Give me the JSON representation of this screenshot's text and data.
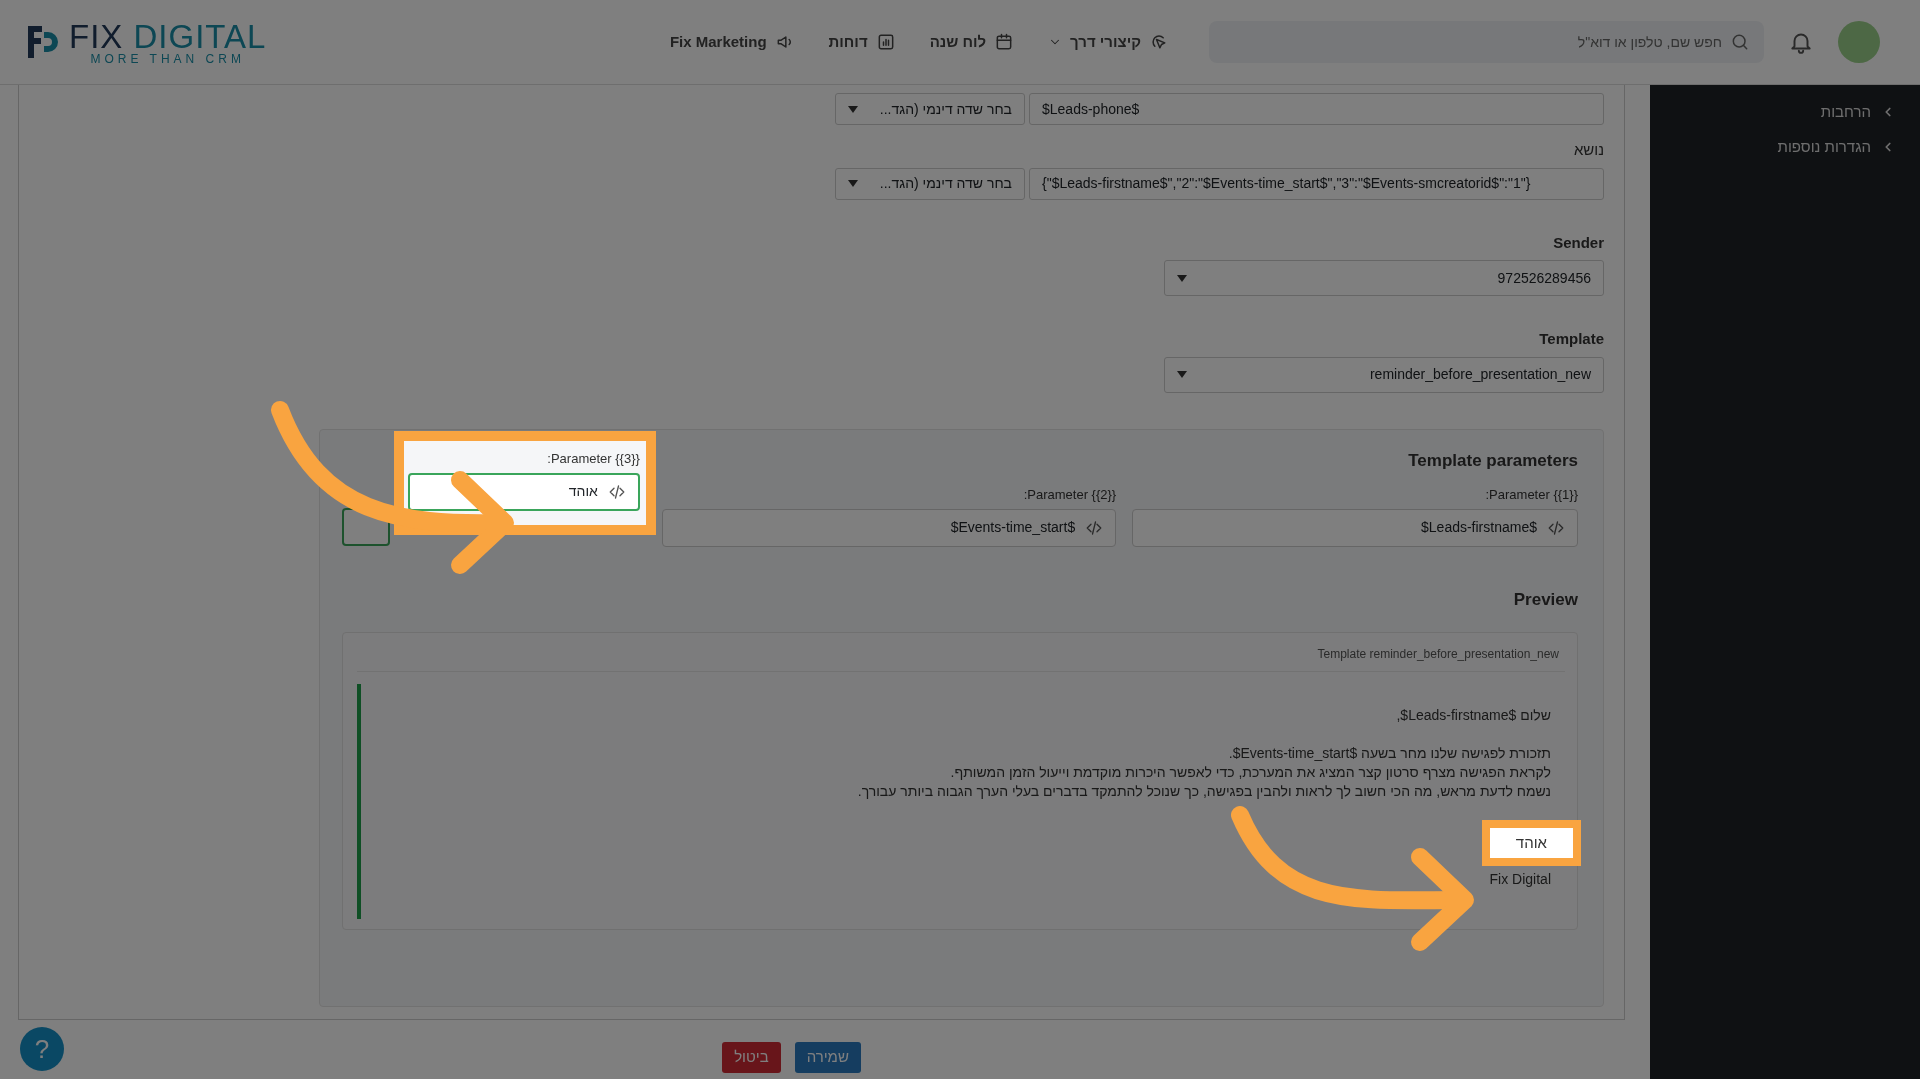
{
  "header": {
    "logo": {
      "word_1": "FIX",
      "word_2": "DIGITAL",
      "tagline": "MORE THAN CRM"
    },
    "nav": [
      {
        "kind": "cursor",
        "label": "קיצורי דרך",
        "dropdown": true
      },
      {
        "kind": "calendar",
        "label": "לוח שנה",
        "dropdown": false
      },
      {
        "kind": "chart",
        "label": "דוחות",
        "dropdown": false
      },
      {
        "kind": "megaphone",
        "label": "Fix Marketing",
        "dropdown": false
      }
    ],
    "search": {
      "placeholder": "חפש שם, טלפון או דוא\"ל"
    }
  },
  "sidebar": {
    "items": [
      {
        "label": "הרחבות"
      },
      {
        "label": "הגדרות נוספות"
      }
    ]
  },
  "form": {
    "phone": {
      "value": "$Leads-phone$",
      "dynamic_field": "בחר שדה דינמי (הגד..."
    },
    "subject": {
      "label": "נושא",
      "value": "{\"$Leads-firstname$\",\"2\":\"$Events-time_start$\",\"3\":\"$Events-smcreatorid$\":\"1\"}",
      "dynamic_field": "בחר שדה דינמי (הגד..."
    },
    "sender": {
      "label": "Sender",
      "value": "972526289456"
    },
    "template": {
      "label": "Template",
      "value": "reminder_before_presentation_new"
    }
  },
  "template_parameters": {
    "title": "Template parameters",
    "parameters": [
      {
        "label": "Parameter {{1}}:",
        "value": "$Leads-firstname$",
        "highlighted": false
      },
      {
        "label": "Parameter {{2}}:",
        "value": "$Events-time_start$",
        "highlighted": false
      },
      {
        "label": "Parameter {{3}}:",
        "value": "אוהד",
        "highlighted": true
      }
    ]
  },
  "preview": {
    "title": "Preview",
    "template_name": "Template reminder_before_presentation_new",
    "paragraphs": [
      {
        "lines": [
          {
            "text": "שלום $Leads-firstname$,",
            "highlighted": false
          }
        ]
      },
      {
        "lines": [
          {
            "text": "תזכורת לפגישה שלנו מחר בשעה $Events-time_start$.",
            "highlighted": false
          },
          {
            "text": "לקראת הפגישה מצרף סרטון קצר המציג את המערכת, כדי לאפשר היכרות מוקדמת וייעול הזמן המשותף.",
            "highlighted": false
          },
          {
            "text": "נשמח לדעת מראש, מה הכי חשוב לך לראות ולהבין בפגישה, כך שנוכל להתמקד בדברים בעלי הערך הגבוה ביותר עבורך.",
            "highlighted": false
          }
        ]
      },
      {
        "lines": [
          {
            "text": "אוהד",
            "highlighted": true
          },
          {
            "text": "Fix Digital",
            "highlighted": false
          }
        ]
      }
    ]
  },
  "buttons": [
    {
      "kind": "save",
      "label": "שמירה"
    },
    {
      "kind": "cancel",
      "label": "ביטול"
    }
  ],
  "help": {
    "label": "?"
  }
}
